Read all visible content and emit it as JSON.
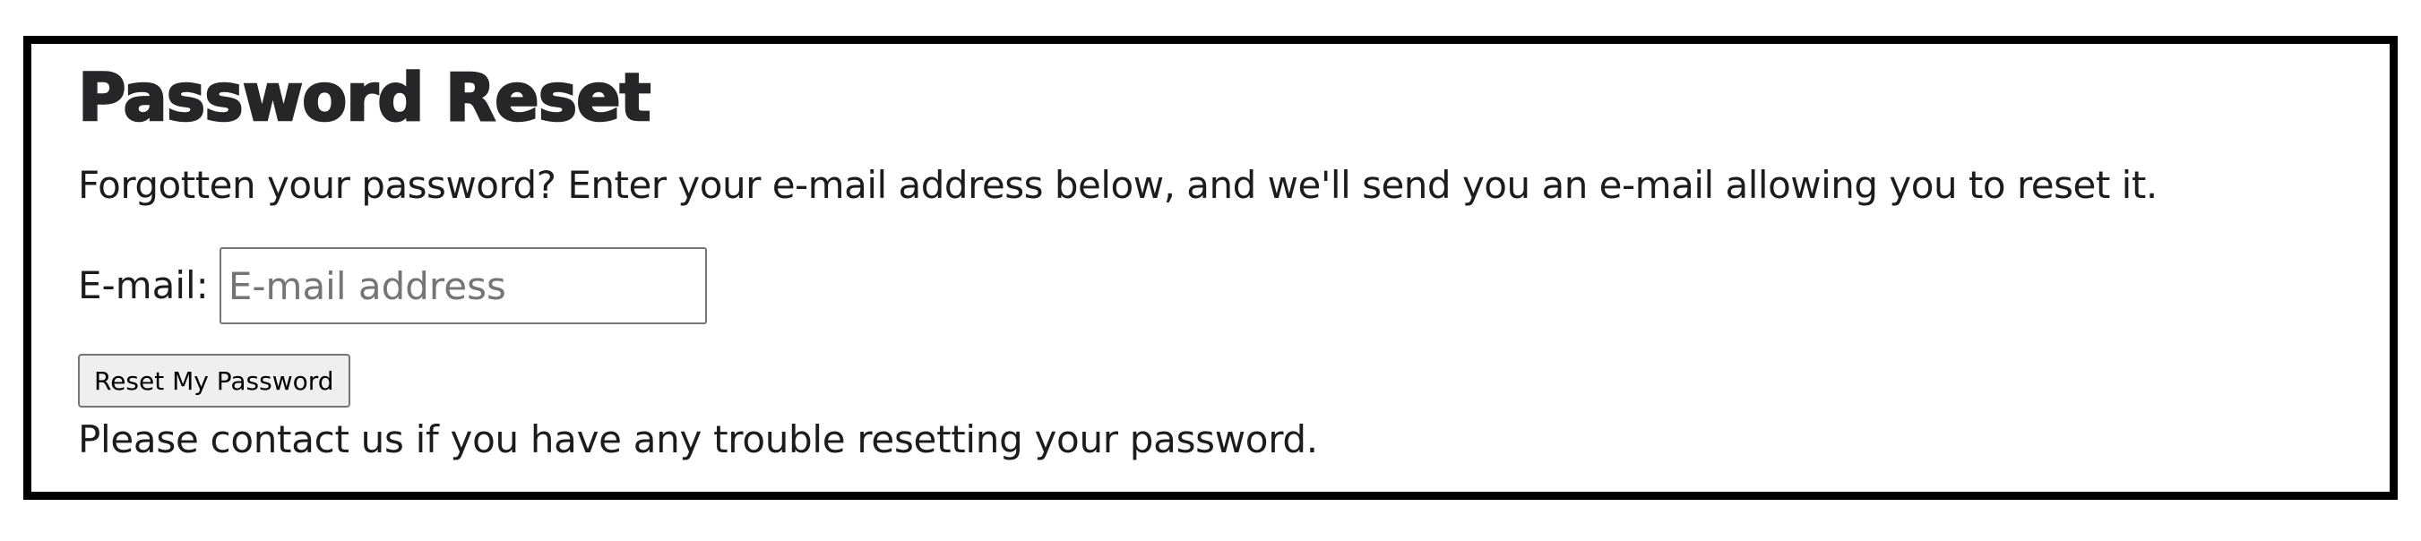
{
  "page": {
    "title": "Password Reset",
    "intro": "Forgotten your password? Enter your e-mail address below, and we'll send you an e-mail allowing you to reset it."
  },
  "form": {
    "email_label": "E-mail:",
    "email_value": "",
    "email_placeholder": "E-mail address",
    "submit_label": "Reset My Password"
  },
  "footer": {
    "note": "Please contact us if you have any trouble resetting your password."
  },
  "colors": {
    "border": "#000000",
    "text": "#1c1c1c",
    "button_bg": "#efefef",
    "input_border": "#767676"
  }
}
